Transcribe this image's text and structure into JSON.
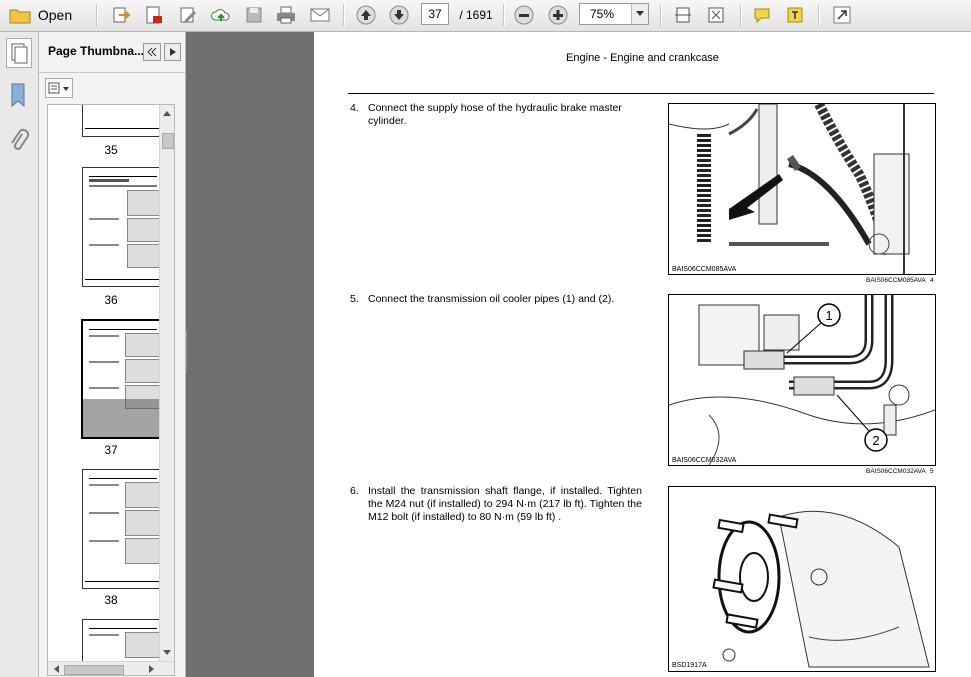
{
  "toolbar": {
    "open_label": "Open",
    "page_current": "37",
    "page_total": "/ 1691",
    "zoom": "75%"
  },
  "panel": {
    "title": "Page Thumbna...",
    "thumb_labels": [
      "35",
      "36",
      "37",
      "38"
    ]
  },
  "page": {
    "header": "Engine - Engine and crankcase",
    "steps": [
      {
        "num": "4.",
        "text": "Connect the supply hose of the hydraulic brake master cylinder."
      },
      {
        "num": "5.",
        "text": "Connect the transmission oil cooler pipes (1) and (2)."
      },
      {
        "num": "6.",
        "text": "Install the transmission shaft flange, if installed. Tighten the M24 nut (if installed) to 294 N·m (217 lb ft). Tighten the M12 bolt (if installed) to 80 N·m (59 lb ft) ."
      }
    ],
    "figures": [
      {
        "code": "BAIS06CCM085AVA",
        "code_below": "BAIS06CCM085AVA",
        "num": "4"
      },
      {
        "code": "BAIS06CCM032AVA",
        "code_below": "BAIS06CCM032AVA",
        "num": "5",
        "callout_1": "1",
        "callout_2": "2"
      },
      {
        "code": "BSD1917A"
      }
    ]
  }
}
